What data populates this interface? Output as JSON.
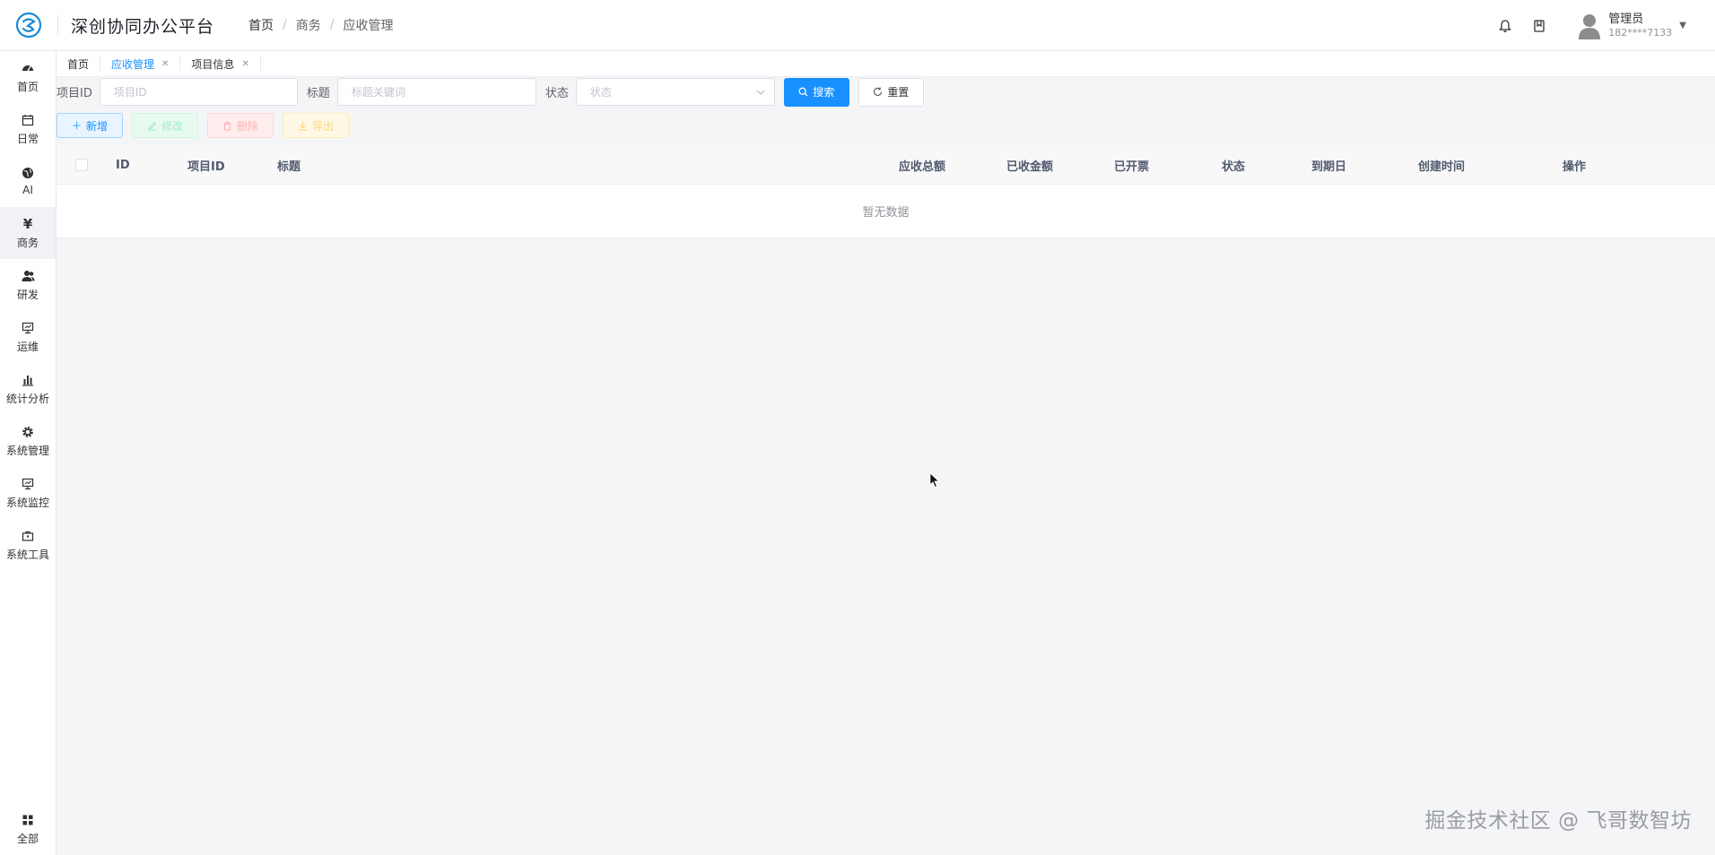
{
  "header": {
    "app_title": "深创协同办公平台",
    "breadcrumb": [
      "首页",
      "商务",
      "应收管理"
    ],
    "breadcrumb_sep": "/",
    "user_name": "管理员",
    "user_phone": "182****7133"
  },
  "sidebar": {
    "items": [
      {
        "label": "首页",
        "icon": "dashboard-icon"
      },
      {
        "label": "日常",
        "icon": "calendar-icon"
      },
      {
        "label": "AI",
        "icon": "globe-icon"
      },
      {
        "label": "商务",
        "icon": "yen-icon"
      },
      {
        "label": "研发",
        "icon": "users-icon"
      },
      {
        "label": "运维",
        "icon": "monitor-icon"
      },
      {
        "label": "统计分析",
        "icon": "bar-chart-icon"
      },
      {
        "label": "系统管理",
        "icon": "gear-icon"
      },
      {
        "label": "系统监控",
        "icon": "monitor-icon"
      },
      {
        "label": "系统工具",
        "icon": "toolbox-icon"
      }
    ],
    "bottom": {
      "label": "全部",
      "icon": "grid-icon"
    },
    "active": "商务"
  },
  "tabs": [
    {
      "label": "首页",
      "closable": false
    },
    {
      "label": "应收管理",
      "closable": true,
      "active": true
    },
    {
      "label": "项目信息",
      "closable": true
    }
  ],
  "search": {
    "project_id_label": "项目ID",
    "project_id_placeholder": "项目ID",
    "title_label": "标题",
    "title_placeholder": "标题关键词",
    "status_label": "状态",
    "status_placeholder": "状态",
    "search_button": "搜索",
    "reset_button": "重置"
  },
  "toolbar": {
    "add": "新增",
    "edit": "修改",
    "delete": "删除",
    "export": "导出"
  },
  "table": {
    "columns": [
      "ID",
      "项目ID",
      "标题",
      "应收总额",
      "已收金额",
      "已开票",
      "状态",
      "到期日",
      "创建时间",
      "操作"
    ],
    "empty_text": "暂无数据"
  },
  "watermark": "掘金技术社区 @ 飞哥数智坊",
  "colors": {
    "primary": "#1890ff",
    "success_light": "#e7faf0",
    "danger_light": "#ffeded",
    "warning_light": "#fff8e6"
  }
}
